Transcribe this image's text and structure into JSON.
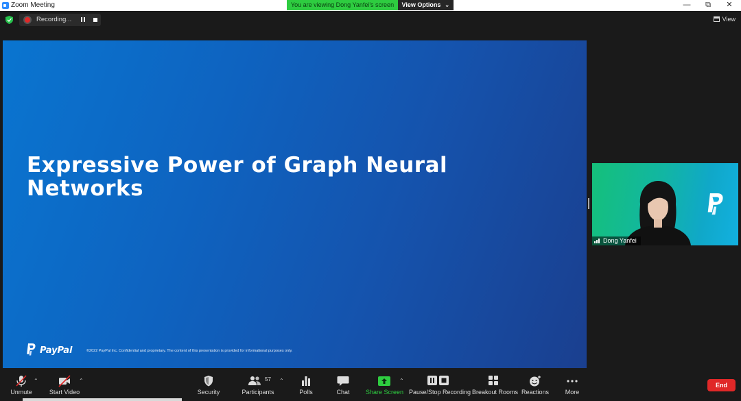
{
  "window": {
    "title": "Zoom Meeting",
    "controls": {
      "minimize": "—",
      "restore": "⧉",
      "close": "✕"
    }
  },
  "share_banner": {
    "text": "You are viewing Dong Yanfei's screen",
    "view_options": "View Options",
    "view_options_caret": "⌄"
  },
  "recording": {
    "label": "Recording..."
  },
  "view_button": {
    "label": "View"
  },
  "slide": {
    "title": "Expressive Power of Graph Neural Networks",
    "logo_text": "PayPal",
    "footer": "©2022 PayPal Inc. Confidential and proprietary. The content of this presentation is provided for informational purposes only."
  },
  "participant": {
    "name": "Dong Yanfei"
  },
  "toolbar": {
    "unmute": "Unmute",
    "start_video": "Start Video",
    "security": "Security",
    "participants": "Participants",
    "participants_count": "57",
    "polls": "Polls",
    "chat": "Chat",
    "share_screen": "Share Screen",
    "pause_stop": "Pause/Stop Recording",
    "breakout": "Breakout Rooms",
    "reactions": "Reactions",
    "more": "More",
    "end": "End",
    "caret": "⌃"
  },
  "colors": {
    "share_green": "#2ecc40",
    "end_red": "#e02828",
    "slide_blue": "#0e63c0",
    "background": "#1a1a1a"
  }
}
